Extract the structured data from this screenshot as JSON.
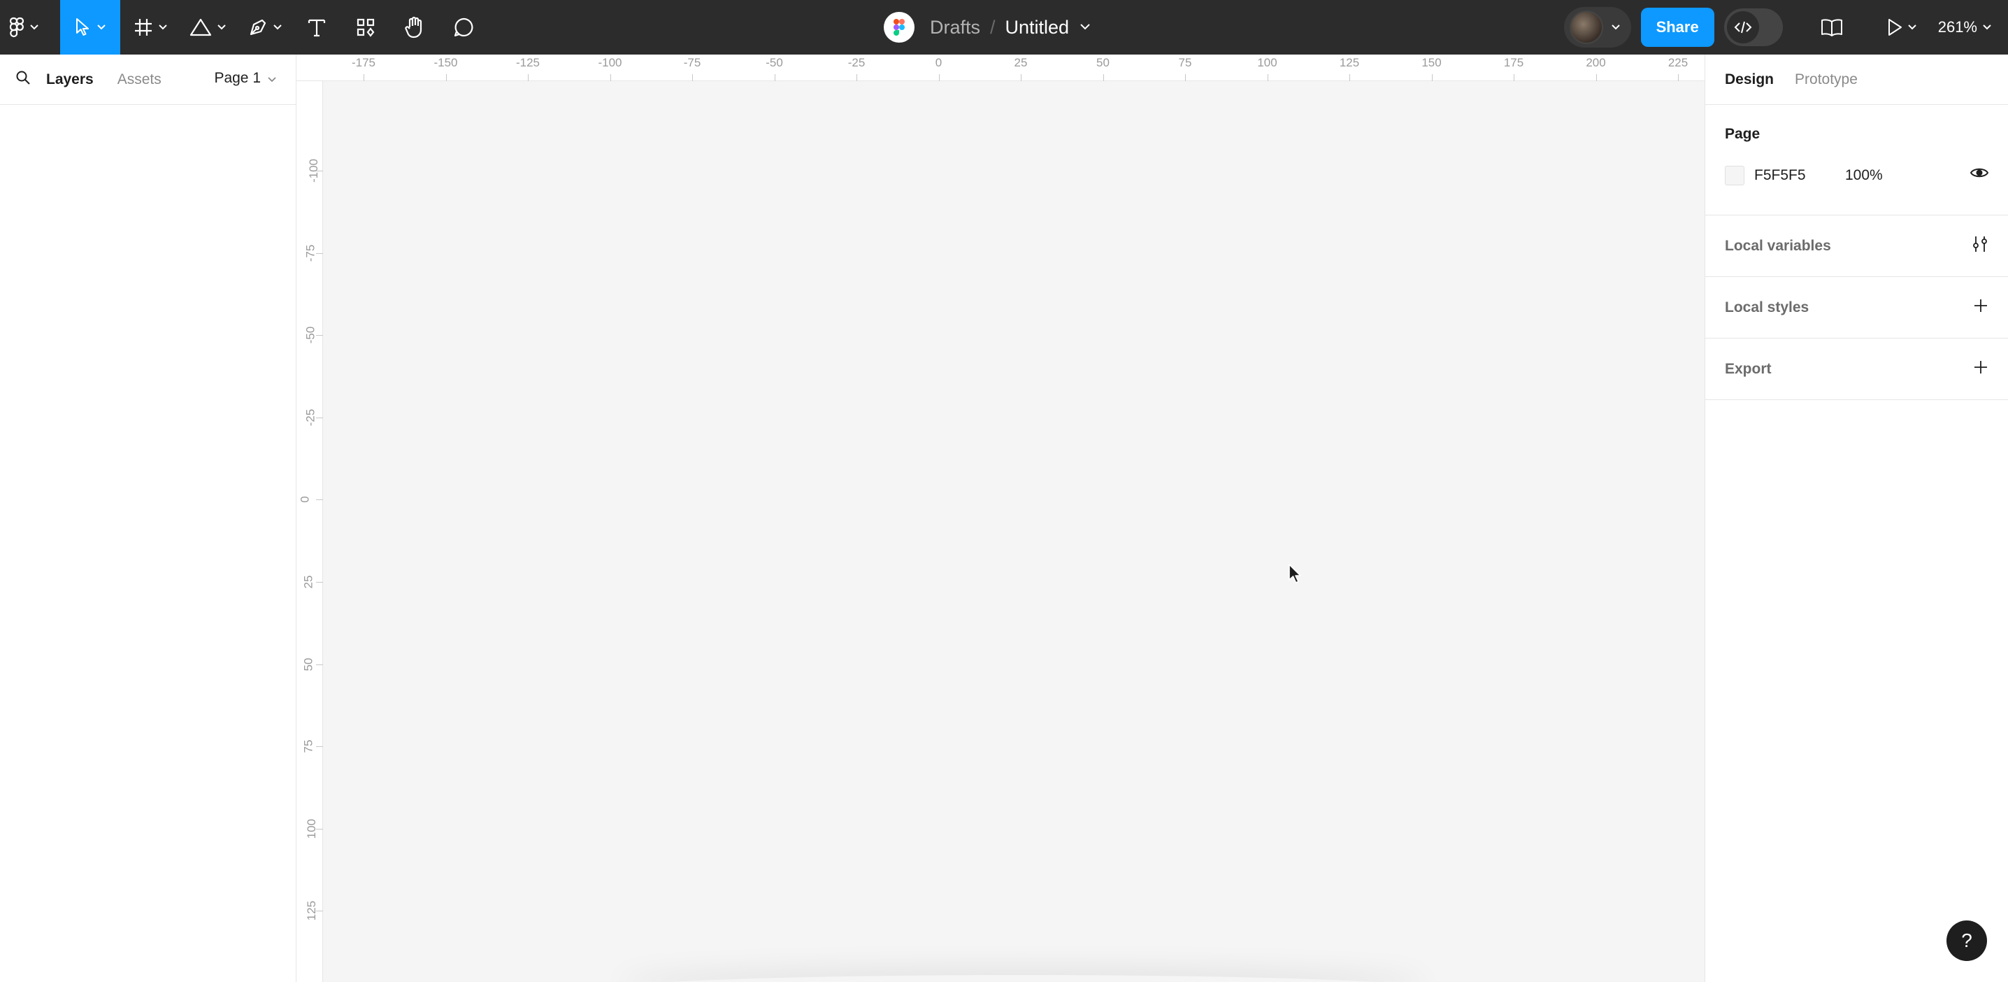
{
  "toolbar": {
    "tools": [
      {
        "name": "main-menu",
        "icon": "figma-logo-icon"
      },
      {
        "name": "move-tool",
        "icon": "pointer-icon",
        "active": true
      },
      {
        "name": "frame-tool",
        "icon": "frame-hash-icon"
      },
      {
        "name": "shape-tool",
        "icon": "triangle-icon"
      },
      {
        "name": "pen-tool",
        "icon": "pen-icon"
      },
      {
        "name": "text-tool",
        "icon": "text-T-icon"
      },
      {
        "name": "resources-tool",
        "icon": "components-icon"
      },
      {
        "name": "hand-tool",
        "icon": "hand-icon"
      },
      {
        "name": "comment-tool",
        "icon": "comment-bubble-icon"
      }
    ],
    "breadcrumb_location": "Drafts",
    "breadcrumb_separator": "/",
    "file_name": "Untitled",
    "share_label": "Share",
    "zoom_label": "261%",
    "accent_color": "#0d99ff"
  },
  "left_panel": {
    "tabs": [
      {
        "label": "Layers",
        "active": true
      },
      {
        "label": "Assets",
        "active": false
      }
    ],
    "page_label": "Page 1"
  },
  "rulers": {
    "x_ticks": [
      "-175",
      "-150",
      "-125",
      "-100",
      "-75",
      "-50",
      "-25",
      "0",
      "25",
      "50",
      "75",
      "100",
      "125",
      "150",
      "175",
      "200",
      "225"
    ],
    "y_ticks": [
      "-100",
      "-75",
      "-50",
      "-25",
      "0",
      "25",
      "50",
      "75",
      "100",
      "125"
    ]
  },
  "right_panel": {
    "tabs": [
      {
        "label": "Design",
        "active": true
      },
      {
        "label": "Prototype",
        "active": false
      }
    ],
    "page_section_title": "Page",
    "page_fill_hex": "F5F5F5",
    "page_fill_opacity": "100%",
    "local_variables_label": "Local variables",
    "local_styles_label": "Local styles",
    "export_label": "Export"
  },
  "help_label": "?"
}
